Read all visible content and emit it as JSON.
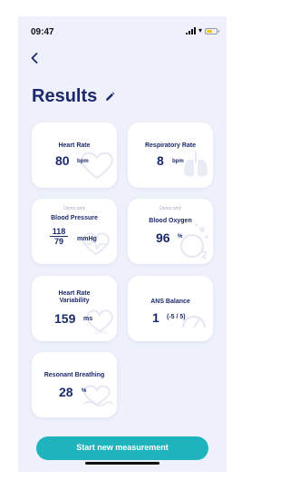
{
  "status": {
    "time": "09:47"
  },
  "header": {
    "title": "Results"
  },
  "cards": {
    "heart_rate": {
      "title": "Heart Rate",
      "value": "80",
      "unit": "bpm"
    },
    "respiratory_rate": {
      "title": "Respiratory Rate",
      "value": "8",
      "unit": "bpm"
    },
    "blood_pressure": {
      "note": "Demo only",
      "title": "Blood Pressure",
      "systolic": "118",
      "diastolic": "79",
      "unit": "mmHg"
    },
    "blood_oxygen": {
      "note": "Demo only",
      "title": "Blood Oxygen",
      "value": "96",
      "unit": "%"
    },
    "hrv": {
      "title_line1": "Heart Rate",
      "title_line2": "Variability",
      "value": "159",
      "unit": "ms"
    },
    "ans_balance": {
      "title": "ANS Balance",
      "value": "1",
      "unit": "(-5 / 5)"
    },
    "resonant_breathing": {
      "title": "Resonant Breathing",
      "value": "28",
      "unit": "%"
    }
  },
  "actions": {
    "start_label": "Start new measurement"
  },
  "colors": {
    "primary": "#1c2a6b",
    "accent": "#1fb3bd",
    "background": "#eef1fb",
    "card": "#ffffff"
  },
  "icons": {
    "back": "chevron-left-icon",
    "edit": "pencil-icon",
    "heart_rate": "heart-icon",
    "respiratory_rate": "lungs-icon",
    "blood_pressure": "pulse-heart-icon",
    "blood_oxygen": "o2-bubbles-icon",
    "hrv": "hrv-heart-icon",
    "ans_balance": "gauge-icon",
    "resonant_breathing": "breathing-wave-icon"
  }
}
